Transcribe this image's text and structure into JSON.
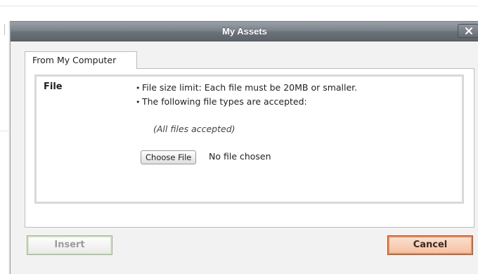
{
  "dialog": {
    "title": "My Assets",
    "close_icon": "close-icon"
  },
  "tabs": [
    {
      "label": "From My Computer",
      "active": true
    }
  ],
  "upload": {
    "field_label": "File",
    "rules": [
      "File size limit: Each file must be 20MB or smaller.",
      "The following file types are accepted:"
    ],
    "accepted_types_note": "(All files accepted)",
    "choose_file_label": "Choose File",
    "no_file_text": "No file chosen"
  },
  "footer": {
    "insert_label": "Insert",
    "cancel_label": "Cancel"
  },
  "colors": {
    "titlebar": "#7c838c",
    "cancel_accent": "#e98c5a",
    "insert_accent": "#d6e4cb"
  }
}
